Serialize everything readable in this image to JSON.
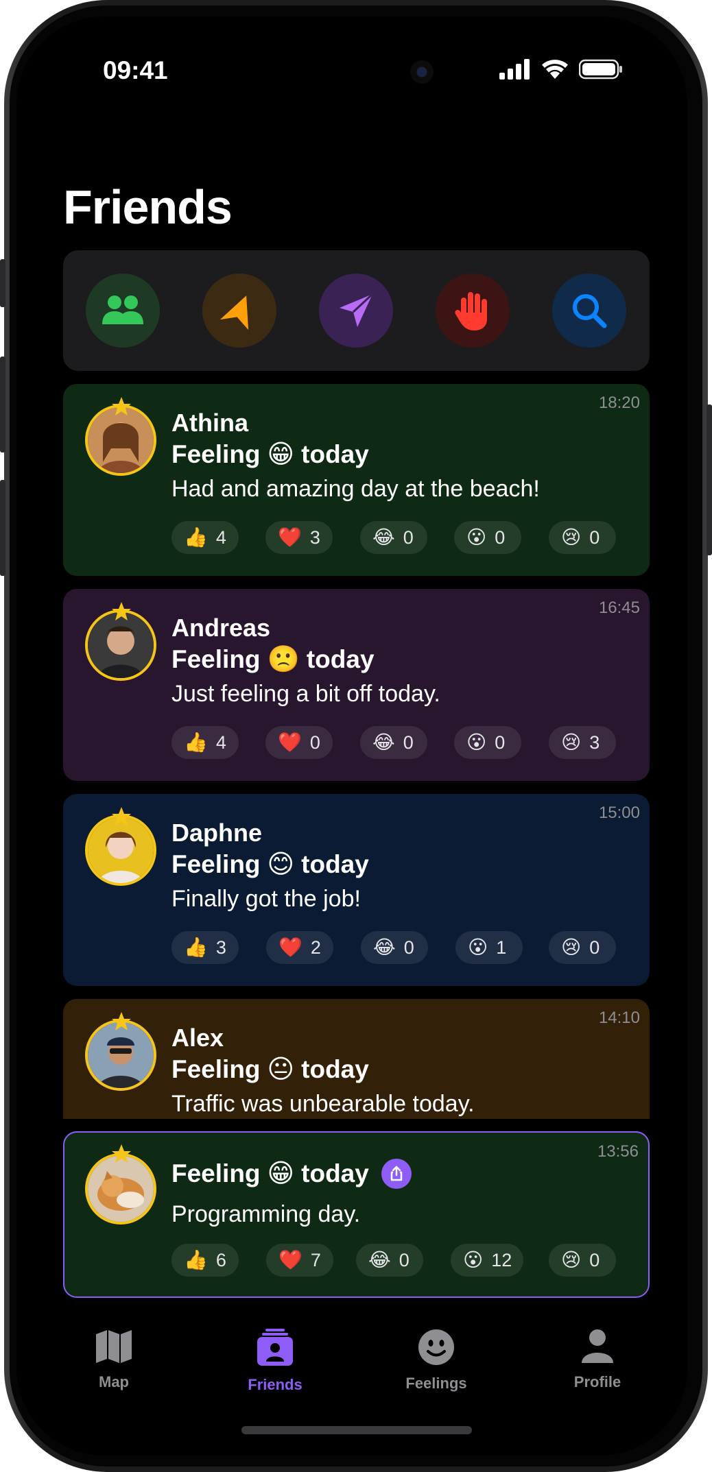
{
  "status_bar": {
    "time": "09:41"
  },
  "page": {
    "title": "Friends"
  },
  "actions": [
    {
      "name": "friends-action",
      "icon": "people-icon",
      "bg": "#1e3a24",
      "fg": "#34c759"
    },
    {
      "name": "nearby-action",
      "icon": "navigation-arrow-icon",
      "bg": "#3d2a12",
      "fg": "#ff9f0a"
    },
    {
      "name": "send-action",
      "icon": "paper-plane-icon",
      "bg": "#3a2255",
      "fg": "#b86bf7"
    },
    {
      "name": "block-action",
      "icon": "hand-stop-icon",
      "bg": "#3d1414",
      "fg": "#ff3b30"
    },
    {
      "name": "search-action",
      "icon": "search-icon",
      "bg": "#102a4a",
      "fg": "#0a84ff"
    }
  ],
  "feeling_prefix": "Feeling",
  "feeling_suffix": "today",
  "posts": [
    {
      "name": "Athina",
      "emoji": "😁",
      "message": "Had and amazing day at the beach!",
      "time": "18:20",
      "bg": "#0f2a14",
      "reactions": [
        {
          "emoji": "👍",
          "count": "4"
        },
        {
          "emoji": "❤️",
          "count": "3"
        },
        {
          "emoji": "😂",
          "count": "0"
        },
        {
          "emoji": "😮",
          "count": "0"
        },
        {
          "emoji": "😢",
          "count": "0"
        }
      ]
    },
    {
      "name": "Andreas",
      "emoji": "🙁",
      "message": "Just feeling a bit off today.",
      "time": "16:45",
      "bg": "#28162f",
      "reactions": [
        {
          "emoji": "👍",
          "count": "4"
        },
        {
          "emoji": "❤️",
          "count": "0"
        },
        {
          "emoji": "😂",
          "count": "0"
        },
        {
          "emoji": "😮",
          "count": "0"
        },
        {
          "emoji": "😢",
          "count": "3"
        }
      ]
    },
    {
      "name": "Daphne",
      "emoji": "😊",
      "message": "Finally got the job!",
      "time": "15:00",
      "bg": "#0a1b33",
      "reactions": [
        {
          "emoji": "👍",
          "count": "3"
        },
        {
          "emoji": "❤️",
          "count": "2"
        },
        {
          "emoji": "😂",
          "count": "0"
        },
        {
          "emoji": "😮",
          "count": "1"
        },
        {
          "emoji": "😢",
          "count": "0"
        }
      ]
    },
    {
      "name": "Alex",
      "emoji": "😐",
      "message": "Traffic was unbearable today.",
      "time": "14:10",
      "bg": "#322008"
    }
  ],
  "my_post": {
    "emoji": "😁",
    "message": "Programming day.",
    "time": "13:56",
    "bg": "#0f2a14",
    "border": "#8e5cf7",
    "reactions": [
      {
        "emoji": "👍",
        "count": "6"
      },
      {
        "emoji": "❤️",
        "count": "7"
      },
      {
        "emoji": "😂",
        "count": "0"
      },
      {
        "emoji": "😮",
        "count": "12"
      },
      {
        "emoji": "😢",
        "count": "0"
      }
    ]
  },
  "tabs": [
    {
      "label": "Map",
      "icon": "map-icon",
      "active": false
    },
    {
      "label": "Friends",
      "icon": "friends-tab-icon",
      "active": true
    },
    {
      "label": "Feelings",
      "icon": "smiley-icon",
      "active": false
    },
    {
      "label": "Profile",
      "icon": "person-icon",
      "active": false
    }
  ],
  "colors": {
    "accent": "#8e5cf7",
    "tab_inactive": "#8e8e93",
    "star": "#f5c518"
  }
}
